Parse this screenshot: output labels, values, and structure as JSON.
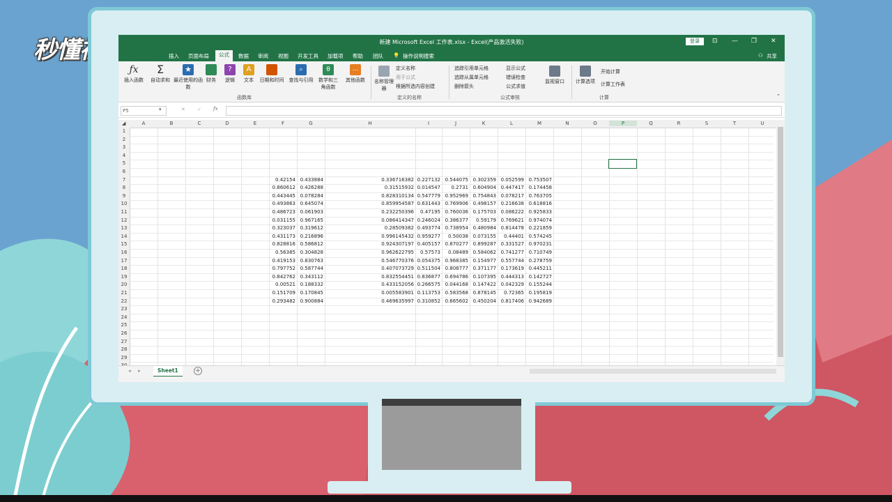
{
  "brand": {
    "logo_text": "秒懂视频"
  },
  "window": {
    "title": "新建 Microsoft Excel 工作表.xlsx - Excel(产品激活失败)",
    "login": "登录",
    "share": "共享",
    "minimize": "—",
    "restore": "❐",
    "close": "✕",
    "ribbon_toggle": "⊡"
  },
  "menu": {
    "items": [
      "插入",
      "页面布局",
      "公式",
      "数据",
      "审阅",
      "视图",
      "开发工具",
      "加载项",
      "帮助",
      "团队",
      "操作说明搜索"
    ],
    "active": "公式"
  },
  "ribbon": {
    "buttons": [
      {
        "label": "插入函数",
        "icon": "fx-icon",
        "color": "#555555"
      },
      {
        "label": "自动求和",
        "icon": "sigma-icon",
        "color": "#555555"
      },
      {
        "label": "最近使用的函数",
        "icon": "star-icon",
        "color": "#2b6cb0"
      },
      {
        "label": "财务",
        "icon": "finance-icon",
        "color": "#2e8b57"
      },
      {
        "label": "逻辑",
        "icon": "logic-icon",
        "color": "#8e44ad"
      },
      {
        "label": "文本",
        "icon": "text-icon",
        "color": "#e0a020"
      },
      {
        "label": "日期和时间",
        "icon": "calendar-icon",
        "color": "#d35400"
      },
      {
        "label": "查找与引用",
        "icon": "lookup-icon",
        "color": "#2b6cb0"
      },
      {
        "label": "数学和三角函数",
        "icon": "math-icon",
        "color": "#2e8b57"
      },
      {
        "label": "其他函数",
        "icon": "more-icon",
        "color": "#e67e22"
      }
    ],
    "group_function_library": "函数库",
    "name_manager": "名称管理器",
    "define_name": "定义名称",
    "use_in_formula": "用于公式",
    "create_from_selection": "根据所选内容创建",
    "group_defined_names": "定义的名称",
    "trace_precedents": "追踪引用单元格",
    "trace_dependents": "追踪从属单元格",
    "remove_arrows": "删除箭头",
    "show_formulas": "显示公式",
    "error_checking": "错误检查",
    "evaluate_formula": "公式求值",
    "watch_window": "监视窗口",
    "group_formula_auditing": "公式审核",
    "calc_options": "计算选项",
    "calc_now": "开始计算",
    "calc_sheet": "计算工作表",
    "group_calculation": "计算"
  },
  "formula_bar": {
    "name_box": "P5",
    "fx": "fx",
    "cancel": "✕",
    "enter": "✓",
    "value": ""
  },
  "columns": [
    "A",
    "B",
    "C",
    "D",
    "E",
    "F",
    "G",
    "H",
    "I",
    "J",
    "K",
    "L",
    "M",
    "N",
    "O",
    "P",
    "Q",
    "R",
    "S",
    "T",
    "U"
  ],
  "rows": [
    "1",
    "2",
    "3",
    "4",
    "5",
    "6",
    "7",
    "8",
    "9",
    "10",
    "11",
    "12",
    "13",
    "14",
    "15",
    "16",
    "17",
    "18",
    "19",
    "20",
    "21",
    "22",
    "23",
    "24",
    "25",
    "26",
    "27",
    "28",
    "29",
    "30"
  ],
  "data_rows": [
    [
      "0.42154",
      "0.433884",
      "0.336716382",
      "0.227132",
      "0.544075",
      "0.302359",
      "0.052599",
      "0.753507"
    ],
    [
      "0.860612",
      "0.426288",
      "0.31515932",
      "0.014547",
      "0.2731",
      "0.604904",
      "0.447417",
      "0.174458"
    ],
    [
      "0.443445",
      "0.078284",
      "0.828310134",
      "0.547779",
      "0.952969",
      "0.754843",
      "0.078217",
      "0.763705"
    ],
    [
      "0.493863",
      "0.645074",
      "0.859954587",
      "0.631443",
      "0.769906",
      "0.498157",
      "0.216638",
      "0.618816"
    ],
    [
      "0.486723",
      "0.061903",
      "0.232250396",
      "0.47195",
      "0.760036",
      "0.175703",
      "0.086222",
      "0.925833"
    ],
    [
      "0.031155",
      "0.967165",
      "0.086414347",
      "0.246024",
      "0.386377",
      "0.59179",
      "0.769621",
      "0.974074"
    ],
    [
      "0.323037",
      "0.319612",
      "0.28509382",
      "0.493774",
      "0.738954",
      "0.480984",
      "0.814478",
      "0.221859"
    ],
    [
      "0.431173",
      "0.216896",
      "0.996145432",
      "0.959277",
      "0.50038",
      "0.073155",
      "0.44401",
      "0.574245"
    ],
    [
      "0.828816",
      "0.586812",
      "0.924307197",
      "0.405157",
      "0.870277",
      "0.899287",
      "0.331527",
      "0.970231"
    ],
    [
      "0.56385",
      "0.304828",
      "0.962622795",
      "0.57573",
      "0.08489",
      "0.584062",
      "0.741277",
      "0.710749"
    ],
    [
      "0.419153",
      "0.830763",
      "0.546770376",
      "0.054375",
      "0.968385",
      "0.154977",
      "0.557744",
      "0.278759"
    ],
    [
      "0.797752",
      "0.587744",
      "0.407073729",
      "0.511504",
      "0.808777",
      "0.371177",
      "0.173619",
      "0.445211"
    ],
    [
      "0.842762",
      "0.343112",
      "0.832554451",
      "0.836877",
      "0.694786",
      "0.107395",
      "0.444313",
      "0.142727"
    ],
    [
      "0.00521",
      "0.188332",
      "0.433152056",
      "0.266575",
      "0.044168",
      "0.147422",
      "0.042329",
      "0.155244"
    ],
    [
      "0.151709",
      "0.170845",
      "0.005583901",
      "0.113753",
      "0.583568",
      "0.878145",
      "0.72365",
      "0.195819"
    ],
    [
      "0.293482",
      "0.900884",
      "0.469635997",
      "0.310852",
      "0.665602",
      "0.450204",
      "0.817406",
      "0.942689"
    ]
  ],
  "sheet": {
    "tab": "Sheet1",
    "add": "+"
  },
  "colors": {
    "excel_green": "#217346",
    "background": "#6aa3cf"
  }
}
